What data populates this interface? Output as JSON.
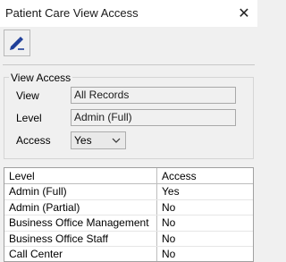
{
  "window": {
    "title": "Patient Care View Access",
    "close_glyph": "✕"
  },
  "toolbar": {
    "edit_icon": "edit-pencil-icon"
  },
  "view_access": {
    "group_label": "View Access",
    "view_label": "View",
    "view_value": "All Records",
    "level_label": "Level",
    "level_value": "Admin (Full)",
    "access_label": "Access",
    "access_value": "Yes"
  },
  "grid": {
    "columns": [
      "Level",
      "Access"
    ],
    "rows": [
      {
        "level": "Admin (Full)",
        "access": "Yes"
      },
      {
        "level": "Admin (Partial)",
        "access": "No"
      },
      {
        "level": "Business Office Management",
        "access": "No"
      },
      {
        "level": "Business Office Staff",
        "access": "No"
      },
      {
        "level": "Call Center",
        "access": "No"
      }
    ]
  }
}
